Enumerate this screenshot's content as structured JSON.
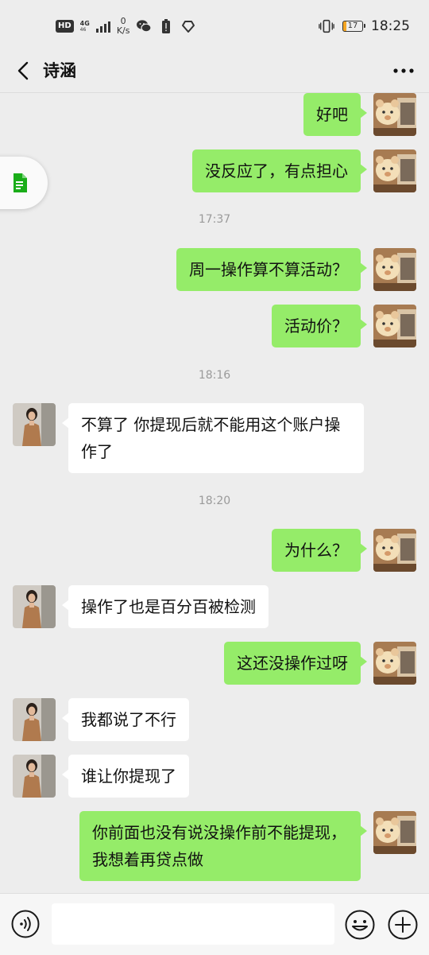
{
  "status_bar": {
    "hd": "HD",
    "network": "4G",
    "network_sub": "46",
    "net_speed_value": "0",
    "net_speed_unit": "K/s",
    "battery_level": "17",
    "time": "18:25"
  },
  "header": {
    "contact_name": "诗涵",
    "back_icon": "chevron-left-icon",
    "more_icon": "more-dots-icon"
  },
  "messages": [
    {
      "side": "out",
      "text": "好吧"
    },
    {
      "side": "out",
      "text": "没反应了，有点担心"
    },
    {
      "type": "time",
      "text": "17:37"
    },
    {
      "side": "out",
      "text": "周一操作算不算活动？"
    },
    {
      "side": "out",
      "text": "活动价？"
    },
    {
      "type": "time",
      "text": "18:16"
    },
    {
      "side": "in",
      "text": "不算了 你提现后就不能用这个账户操作了"
    },
    {
      "type": "time",
      "text": "18:20"
    },
    {
      "side": "out",
      "text": "为什么？"
    },
    {
      "side": "in",
      "text": "操作了也是百分百被检测"
    },
    {
      "side": "out",
      "text": "这还没操作过呀"
    },
    {
      "side": "in",
      "text": "我都说了不行"
    },
    {
      "side": "in",
      "text": "谁让你提现了"
    },
    {
      "side": "out",
      "text": "你前面也没有说没操作前不能提现，我想着再贷点做"
    }
  ],
  "input_bar": {
    "voice_icon": "voice-icon",
    "placeholder": "",
    "emoji_icon": "emoji-icon",
    "plus_icon": "plus-icon"
  },
  "colors": {
    "background": "#ededed",
    "outgoing_bubble": "#95ec69",
    "incoming_bubble": "#ffffff",
    "timestamp": "#9a9a9a"
  }
}
